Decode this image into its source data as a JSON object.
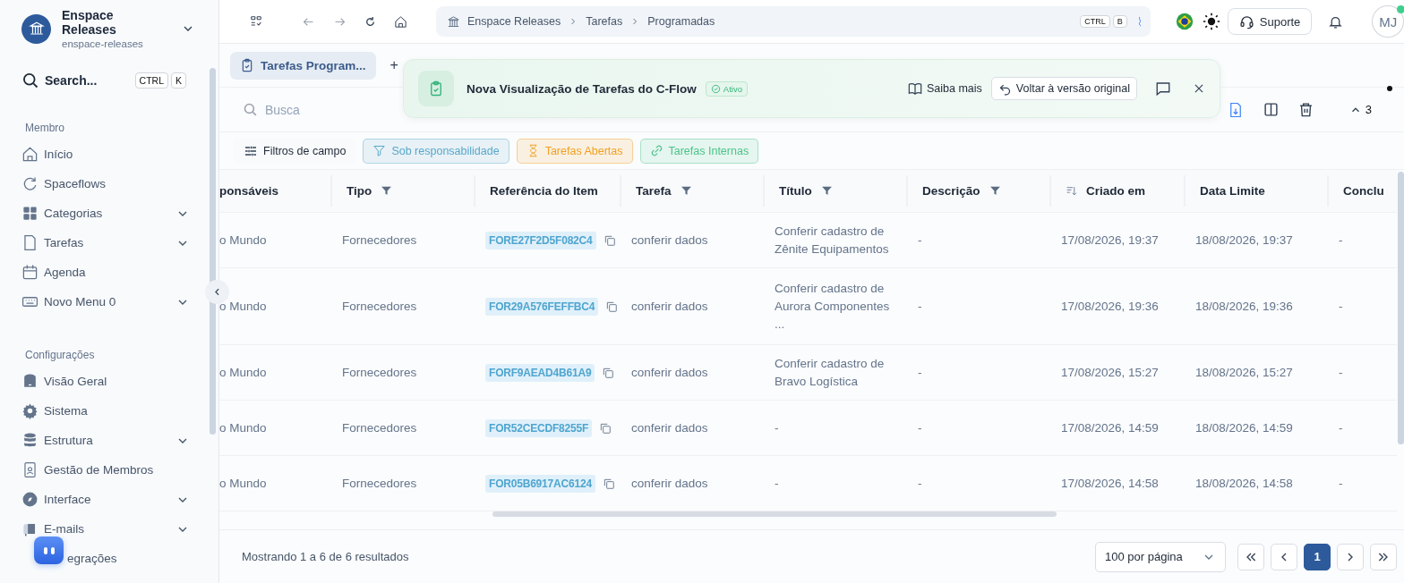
{
  "workspace": {
    "name": "Enspace Releases",
    "slug": "enspace-releases"
  },
  "sidebar": {
    "search": {
      "placeholder": "Search...",
      "keys": [
        "CTRL",
        "K"
      ]
    },
    "sections": [
      {
        "title": "Membro",
        "items": [
          {
            "label": "Início",
            "expandable": false
          },
          {
            "label": "Spaceflows",
            "expandable": false
          },
          {
            "label": "Categorias",
            "expandable": true
          },
          {
            "label": "Tarefas",
            "expandable": true
          },
          {
            "label": "Agenda",
            "expandable": false
          },
          {
            "label": "Novo Menu 0",
            "expandable": true
          }
        ]
      },
      {
        "title": "Configurações",
        "items": [
          {
            "label": "Visão Geral",
            "expandable": false
          },
          {
            "label": "Sistema",
            "expandable": false
          },
          {
            "label": "Estrutura",
            "expandable": true
          },
          {
            "label": "Gestão de Membros",
            "expandable": false
          },
          {
            "label": "Interface",
            "expandable": true
          },
          {
            "label": "E-mails",
            "expandable": true
          },
          {
            "label": "egrações",
            "expandable": false
          }
        ]
      }
    ]
  },
  "topbar": {
    "breadcrumb": [
      "Enspace Releases",
      "Tarefas",
      "Programadas"
    ],
    "shortcut": [
      "CTRL",
      "B"
    ],
    "support": "Suporte",
    "avatar": "MJ",
    "online": true
  },
  "tabs": [
    {
      "label": "Tarefas Program...",
      "selected": true
    }
  ],
  "add_tab": "+",
  "search": {
    "placeholder": "Busca"
  },
  "toolbar": {
    "count": "3"
  },
  "banner": {
    "title": "Nova Visualização de Tarefas do C-Flow",
    "badge": "Ativo",
    "learn_more": "Saiba mais",
    "revert": "Voltar à versão original"
  },
  "filters": [
    {
      "label": "Filtros de campo",
      "kind": "fields"
    },
    {
      "label": "Sob responsabilidade",
      "kind": "chip",
      "color": "#5aa7c9"
    },
    {
      "label": "Tarefas Abertas",
      "kind": "chip",
      "color": "#f0a020"
    },
    {
      "label": "Tarefas Internas",
      "kind": "chip",
      "color": "#4cc38a"
    }
  ],
  "table": {
    "columns": [
      {
        "label": "ponsáveis",
        "filter": false,
        "sorted": false
      },
      {
        "label": "Tipo",
        "filter": true,
        "sorted": false
      },
      {
        "label": "Referência do Item",
        "filter": false,
        "sorted": false
      },
      {
        "label": "Tarefa",
        "filter": true,
        "sorted": false
      },
      {
        "label": "Título",
        "filter": true,
        "sorted": false
      },
      {
        "label": "Descrição",
        "filter": true,
        "sorted": false
      },
      {
        "label": "Criado em",
        "filter": false,
        "sorted": true
      },
      {
        "label": "Data Limite",
        "filter": false,
        "sorted": false
      },
      {
        "label": "Conclu",
        "filter": false,
        "sorted": false
      }
    ],
    "rows": [
      [
        "o Mundo",
        "Fornecedores",
        "FORE27F2D5F082C4",
        "conferir dados",
        "Conferir cadastro de Zênite Equipamentos",
        "-",
        "17/08/2026, 19:37",
        "18/08/2026, 19:37",
        "-"
      ],
      [
        "o Mundo",
        "Fornecedores",
        "FOR29A576FEFFBC4",
        "conferir dados",
        "Conferir cadastro de Aurora Componentes ...",
        "-",
        "17/08/2026, 19:36",
        "18/08/2026, 19:36",
        "-"
      ],
      [
        "o Mundo",
        "Fornecedores",
        "FORF9AEAD4B61A9",
        "conferir dados",
        "Conferir cadastro de Bravo Logística",
        "-",
        "17/08/2026, 15:27",
        "18/08/2026, 15:27",
        "-"
      ],
      [
        "o Mundo",
        "Fornecedores",
        "FOR52CECDF8255F",
        "conferir dados",
        "-",
        "-",
        "17/08/2026, 14:59",
        "18/08/2026, 14:59",
        "-"
      ],
      [
        "o Mundo",
        "Fornecedores",
        "FOR05B6917AC6124",
        "conferir dados",
        "-",
        "-",
        "17/08/2026, 14:58",
        "18/08/2026, 14:58",
        "-"
      ]
    ]
  },
  "footer": {
    "summary": "Mostrando 1 a 6 de 6 resultados",
    "page_size": "100 por página",
    "pages": [
      {
        "label": "1",
        "selected": true
      }
    ]
  }
}
